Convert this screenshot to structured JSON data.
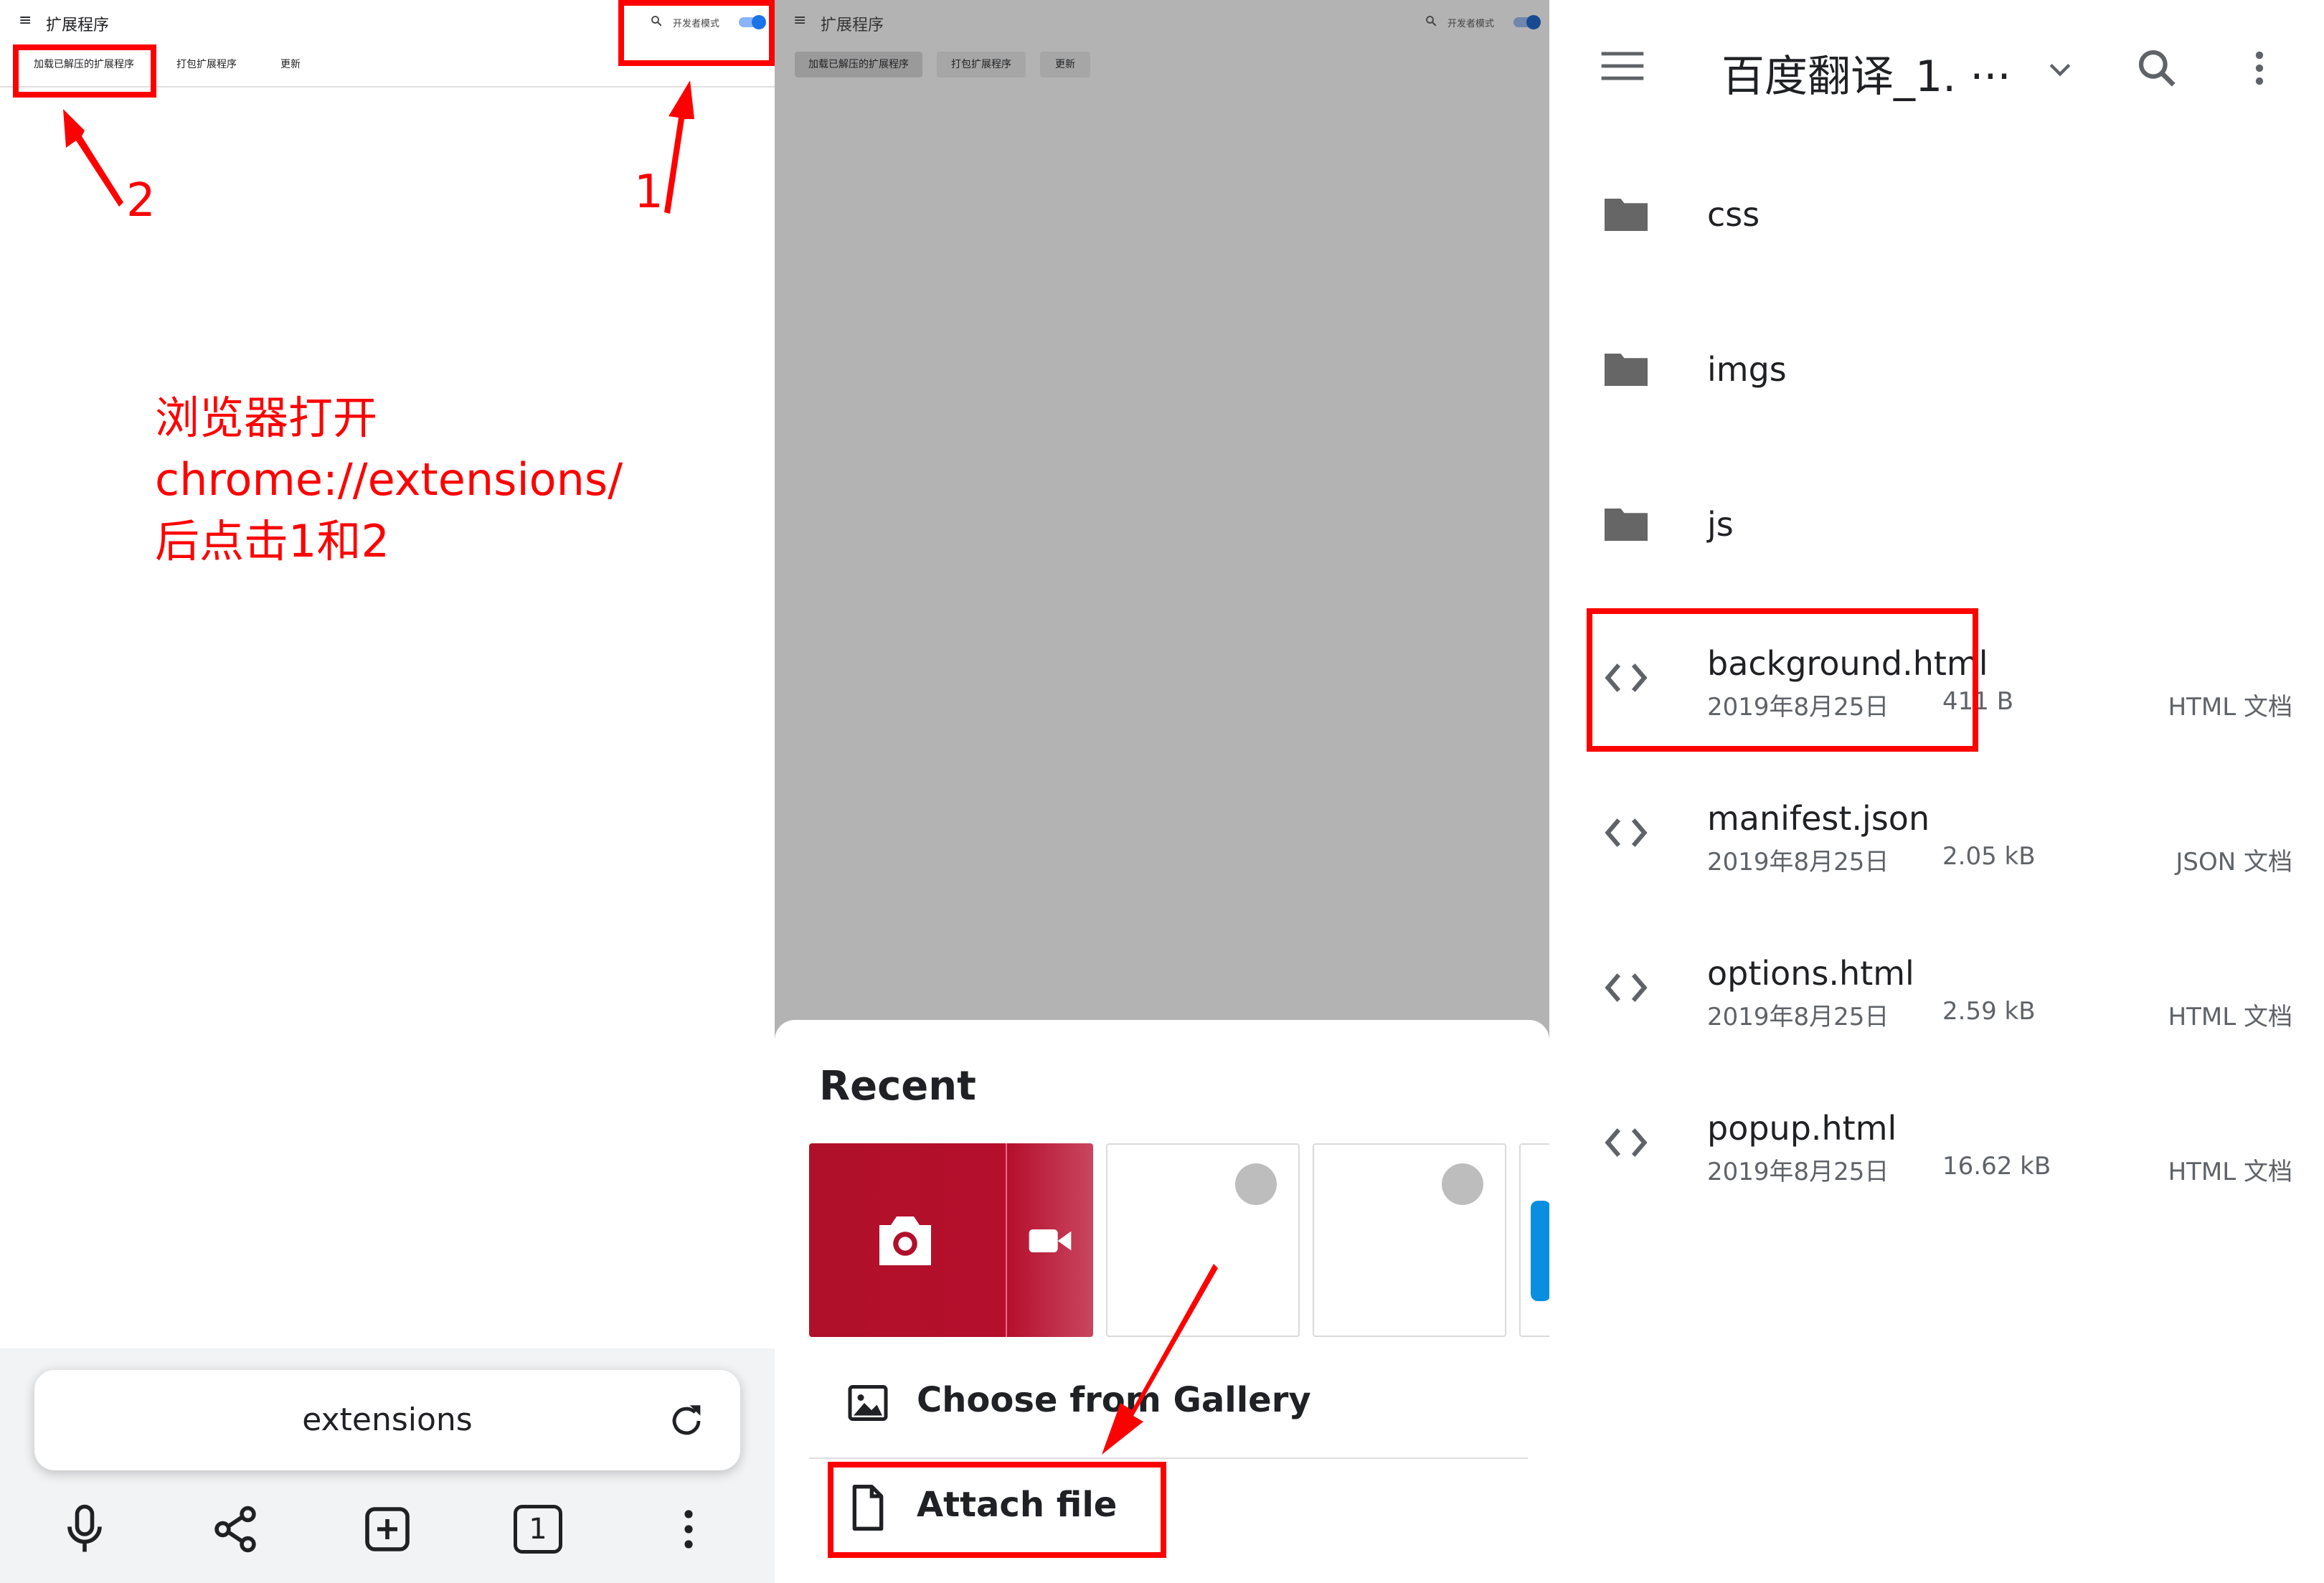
{
  "colors": {
    "annotation_red": "#ff0000",
    "scrim_gray": "#b3b3b3",
    "toggle_blue": "#1a73e8",
    "thumb_red": "#b0102a",
    "fm_icon_gray": "#666666"
  },
  "left_panel": {
    "header": {
      "menu_icon": "menu-icon",
      "title": "扩展程序",
      "search_icon": "search-icon",
      "dev_mode_label": "开发者模式",
      "dev_mode_on": true
    },
    "toolbar": {
      "load_unpacked": "加载已解压的扩展程序",
      "pack_extension": "打包扩展程序",
      "update": "更新"
    },
    "annotations": {
      "label_1": "1",
      "label_2": "2",
      "instruction_lines": [
        "浏览器打开",
        " chrome://extensions/",
        "后点击1和2"
      ]
    },
    "address_bar": {
      "text": "extensions",
      "reload_icon": "reload-icon"
    },
    "bottom_nav": {
      "mic_icon": "microphone-icon",
      "share_icon": "share-icon",
      "new_tab_icon": "new-tab-icon",
      "tab_count": "1",
      "more_icon": "more-vert-icon"
    }
  },
  "middle_panel": {
    "header": {
      "title": "扩展程序",
      "dev_mode_label": "开发者模式"
    },
    "toolbar": {
      "load_unpacked": "加载已解压的扩展程序",
      "pack_extension": "打包扩展程序",
      "update": "更新"
    },
    "sheet": {
      "recent_label": "Recent",
      "camera_icon": "camera-icon",
      "video_icon": "video-camera-icon",
      "choose_gallery": "Choose from Gallery",
      "attach_file": "Attach file",
      "gallery_icon": "image-icon",
      "file_icon": "file-icon"
    }
  },
  "right_panel": {
    "header": {
      "menu_icon": "menu-icon",
      "title": "百度翻译_1. ···",
      "dropdown_icon": "chevron-down-icon",
      "search_icon": "search-icon",
      "more_icon": "more-vert-icon"
    },
    "folders": [
      {
        "name": "css"
      },
      {
        "name": "imgs"
      },
      {
        "name": "js"
      }
    ],
    "files": [
      {
        "name": "background.html",
        "date": "2019年8月25日",
        "size": "411 B",
        "type": "HTML 文档"
      },
      {
        "name": "manifest.json",
        "date": "2019年8月25日",
        "size": "2.05 kB",
        "type": "JSON 文档"
      },
      {
        "name": "options.html",
        "date": "2019年8月25日",
        "size": "2.59 kB",
        "type": "HTML 文档"
      },
      {
        "name": "popup.html",
        "date": "2019年8月25日",
        "size": "16.62 kB",
        "type": "HTML 文档"
      }
    ]
  }
}
